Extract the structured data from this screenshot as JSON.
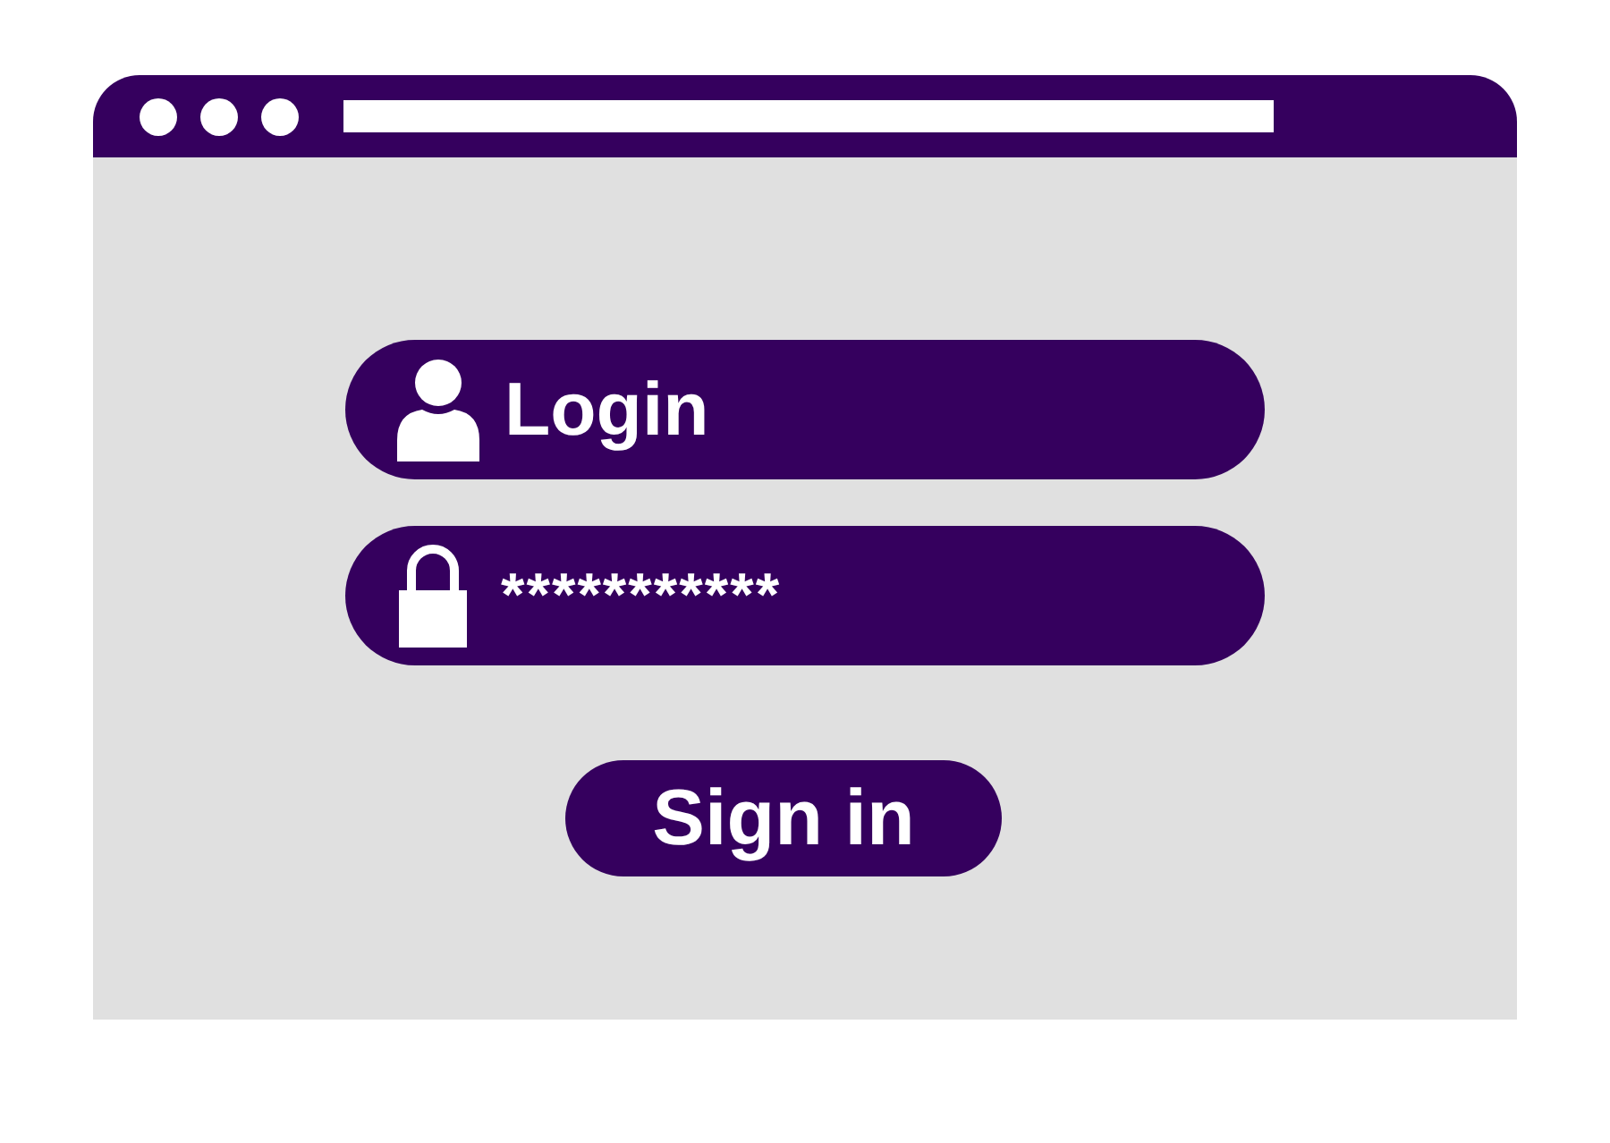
{
  "fields": [
    {
      "kind": "user",
      "value": "Login"
    },
    {
      "kind": "password",
      "value": "***********"
    }
  ],
  "button": {
    "label": "Sign in"
  }
}
